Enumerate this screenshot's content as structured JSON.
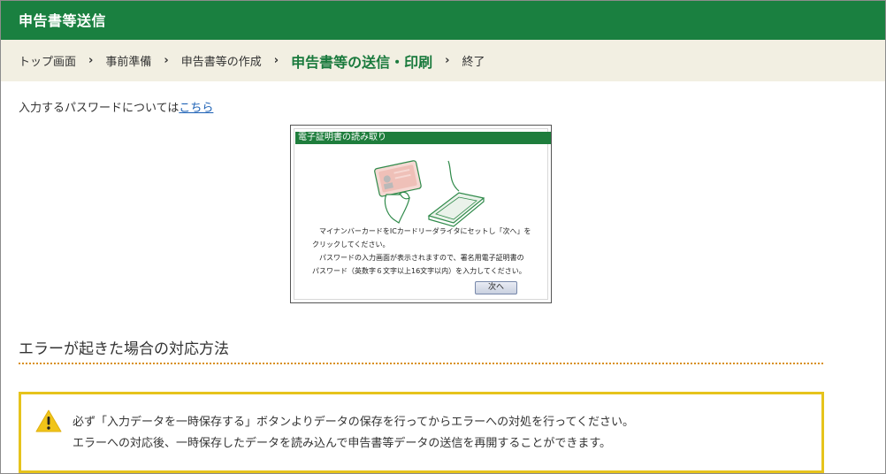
{
  "header": {
    "title": "申告書等送信"
  },
  "breadcrumb": {
    "items": [
      {
        "label": "トップ画面",
        "active": false
      },
      {
        "label": "事前準備",
        "active": false
      },
      {
        "label": "申告書等の作成",
        "active": false
      },
      {
        "label": "申告書等の送信・印刷",
        "active": true
      },
      {
        "label": "終了",
        "active": false
      }
    ],
    "separator": "›"
  },
  "intro": {
    "text": "入力するパスワードについては",
    "link_label": "こちら"
  },
  "dialog": {
    "title": "電子証明書の読み取り",
    "lines": [
      "　マイナンバーカードをICカードリーダライタにセットし「次へ」を",
      "クリックしてください。",
      "　パスワードの入力画面が表示されますので、署名用電子証明書の",
      "パスワード（英数字６文字以上16文字以内）を入力してください。"
    ],
    "next_button": "次へ",
    "illustration_icon": "card-reader-icon"
  },
  "section": {
    "title": "エラーが起きた場合の対応方法"
  },
  "alert": {
    "icon": "warning-icon",
    "line1": "必ず「入力データを一時保存する」ボタンよりデータの保存を行ってからエラーへの対処を行ってください。",
    "line2": "エラーへの対応後、一時保存したデータを読み込んで申告書等データの送信を再開することができます。"
  },
  "colors": {
    "header_bg": "#1a8040",
    "crumb_bg": "#f2efe2",
    "active_crumb": "#1a7a3d",
    "link": "#1a5fb4",
    "alert_border": "#e6c31c",
    "divider": "#d9901f"
  }
}
